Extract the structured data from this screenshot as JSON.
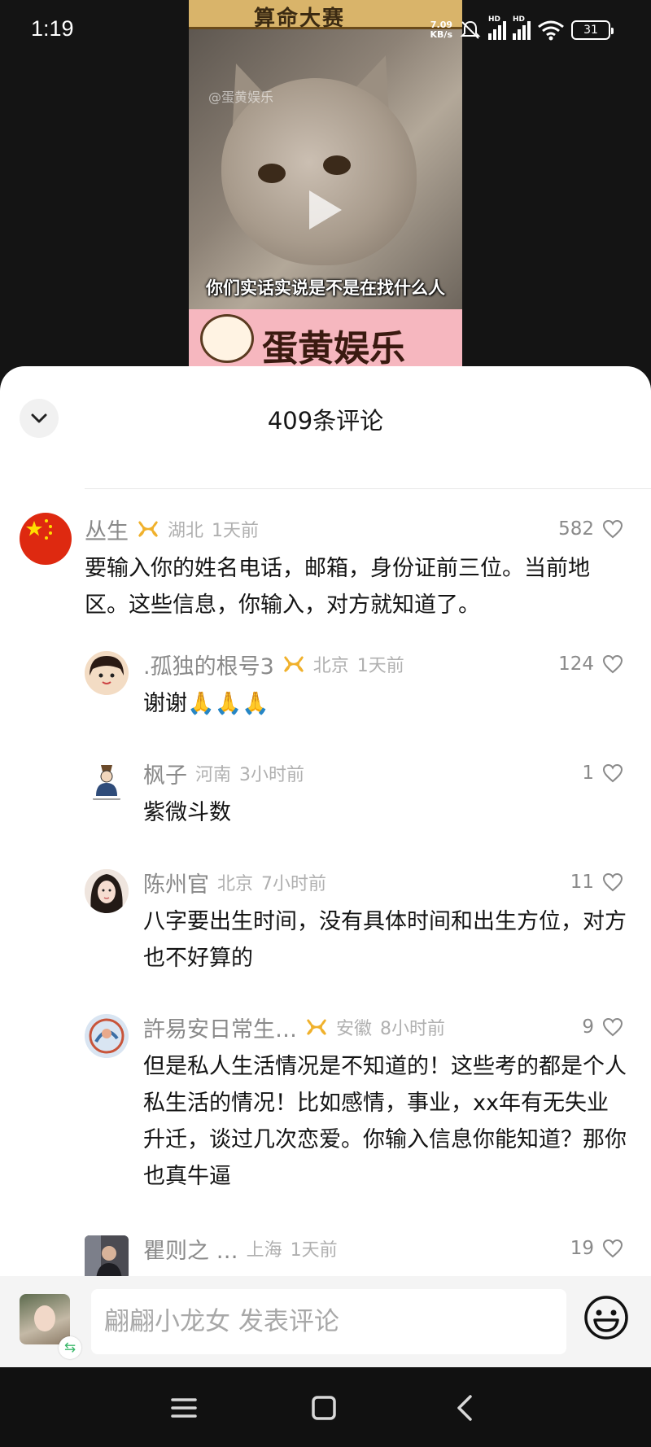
{
  "status_bar": {
    "time": "1:19",
    "net_speed_value": "7.09",
    "net_speed_unit": "KB/s",
    "signal_1_label": "HD",
    "signal_2_label": "HD",
    "battery": "31"
  },
  "video": {
    "top_banner": "算命大赛",
    "watermark": "@蛋黄娱乐",
    "subtitle": "你们实话实说是不是在找什么人",
    "bottom_banner": "蛋黄娱乐"
  },
  "sheet": {
    "title": "409条评论"
  },
  "comments": [
    {
      "name": "丛生",
      "location": "湖北",
      "time": "1天前",
      "likes": "582",
      "body": "要输入你的姓名电话，邮箱，身份证前三位。当前地区。这些信息，你输入，对方就知道了。",
      "badge": true
    },
    {
      "name": ".孤独的根号3",
      "location": "北京",
      "time": "1天前",
      "likes": "124",
      "body": "谢谢🙏🙏🙏",
      "badge": true
    },
    {
      "name": "枫子",
      "location": "河南",
      "time": "3小时前",
      "likes": "1",
      "body": "紫微斗数",
      "badge": false
    },
    {
      "name": "陈州官",
      "location": "北京",
      "time": "7小时前",
      "likes": "11",
      "body": "八字要出生时间，没有具体时间和出生方位，对方也不好算的",
      "badge": false
    },
    {
      "name": "許易安日常生…",
      "location": "安徽",
      "time": "8小时前",
      "likes": "9",
      "body": "但是私人生活情况是不知道的！这些考的都是个人私生活的情况！比如感情，事业，xx年有无失业升迁，谈过几次恋爱。你输入信息你能知道？那你也真牛逼",
      "badge": true
    },
    {
      "name": "瞿则之 …",
      "location": "上海",
      "time": "1天前",
      "likes": "19",
      "body": "",
      "badge": false
    }
  ],
  "input_bar": {
    "placeholder": "翩翩小龙女 发表评论",
    "switch_glyph": "⇆"
  },
  "colors": {
    "badge": "#f0b12c",
    "sheet_bg": "#ffffff",
    "switch_green": "#3bb86b"
  }
}
